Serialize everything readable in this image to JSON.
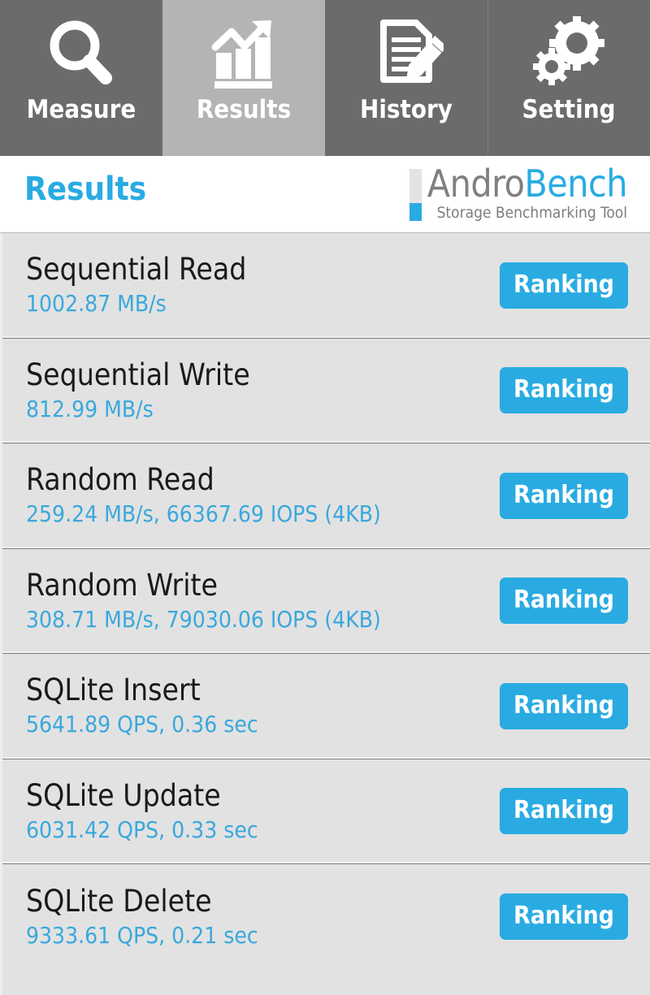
{
  "tabs": [
    {
      "label": "Measure",
      "icon": "magnifier-icon",
      "active": false
    },
    {
      "label": "Results",
      "icon": "bar-chart-trend-icon",
      "active": true
    },
    {
      "label": "History",
      "icon": "document-pencil-icon",
      "active": false
    },
    {
      "label": "Setting",
      "icon": "gears-icon",
      "active": false
    }
  ],
  "header": {
    "page_title": "Results",
    "brand_name_part1": "Andro",
    "brand_name_part2": "Bench",
    "tagline": "Storage Benchmarking Tool"
  },
  "colors": {
    "accent_blue": "#29abe2",
    "value_blue": "#3aa8dd",
    "tabbar_inactive": "#6b6b6b",
    "tabbar_active": "#b4b4b4",
    "row_background": "#e2e2e2",
    "row_divider": "#7d7d7d",
    "title_text": "#1a1a1a",
    "brand_gray": "#808080"
  },
  "results": [
    {
      "title": "Sequential Read",
      "value": "1002.87 MB/s",
      "button": "Ranking"
    },
    {
      "title": "Sequential Write",
      "value": "812.99 MB/s",
      "button": "Ranking"
    },
    {
      "title": "Random Read",
      "value": "259.24 MB/s, 66367.69 IOPS (4KB)",
      "button": "Ranking"
    },
    {
      "title": "Random Write",
      "value": "308.71 MB/s, 79030.06 IOPS (4KB)",
      "button": "Ranking"
    },
    {
      "title": "SQLite Insert",
      "value": "5641.89 QPS, 0.36 sec",
      "button": "Ranking"
    },
    {
      "title": "SQLite Update",
      "value": "6031.42 QPS, 0.33 sec",
      "button": "Ranking"
    },
    {
      "title": "SQLite Delete",
      "value": "9333.61 QPS, 0.21 sec",
      "button": "Ranking"
    }
  ]
}
